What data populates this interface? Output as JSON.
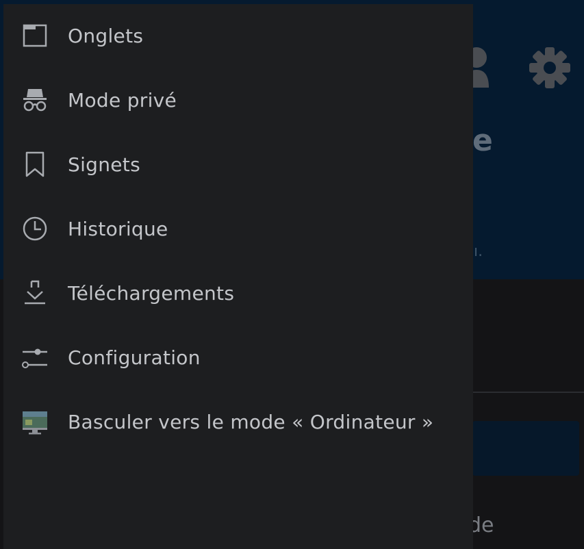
{
  "drawer": {
    "items": [
      {
        "label": "Onglets",
        "icon": "tabs-icon"
      },
      {
        "label": "Mode privé",
        "icon": "incognito-icon"
      },
      {
        "label": "Signets",
        "icon": "bookmark-icon"
      },
      {
        "label": "Historique",
        "icon": "history-clock-icon"
      },
      {
        "label": "Téléchargements",
        "icon": "download-icon"
      },
      {
        "label": "Configuration",
        "icon": "settings-sliders-icon"
      },
      {
        "label": "Basculer vers le mode « Ordinateur »",
        "icon": "desktop-monitor-icon"
      }
    ]
  },
  "background_page": {
    "heading_fragment": "e",
    "sub_fragment": "ı.",
    "bottom_fragment": "de",
    "header_color": "#051a2f"
  }
}
